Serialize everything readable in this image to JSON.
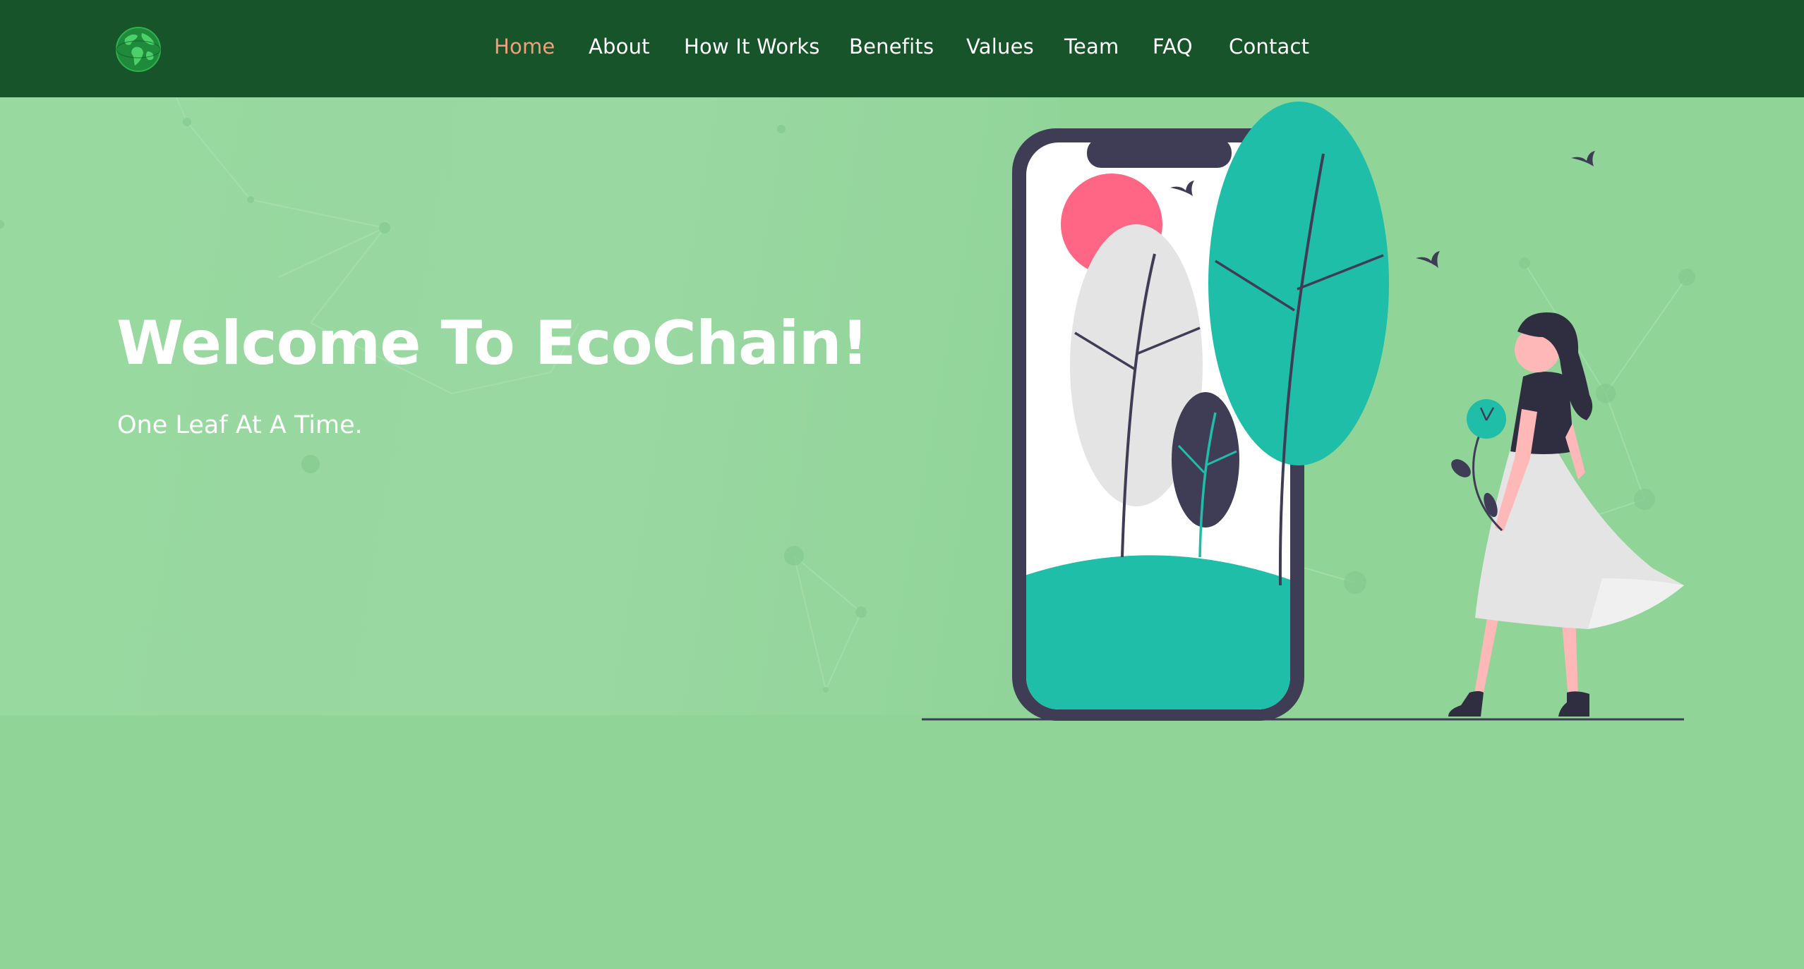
{
  "header": {
    "logo_icon": "globe-icon",
    "nav": [
      {
        "label": "Home",
        "active": true
      },
      {
        "label": "About",
        "active": false
      },
      {
        "label": "How It Works",
        "active": false
      },
      {
        "label": "Benefits",
        "active": false
      },
      {
        "label": "Values",
        "active": false
      },
      {
        "label": "Team",
        "active": false
      },
      {
        "label": "FAQ",
        "active": false
      },
      {
        "label": "Contact",
        "active": false
      }
    ]
  },
  "hero": {
    "title": "Welcome To EcoChain!",
    "subtitle": "One Leaf At A Time.",
    "illustration_icon": "phone-trees-woman-illustration"
  },
  "colors": {
    "header_bg": "#175429",
    "page_bg": "#90d498",
    "active_nav": "#f2a07c",
    "teal": "#1fbea8",
    "dark": "#3f3d56",
    "sun": "#ff6584"
  }
}
